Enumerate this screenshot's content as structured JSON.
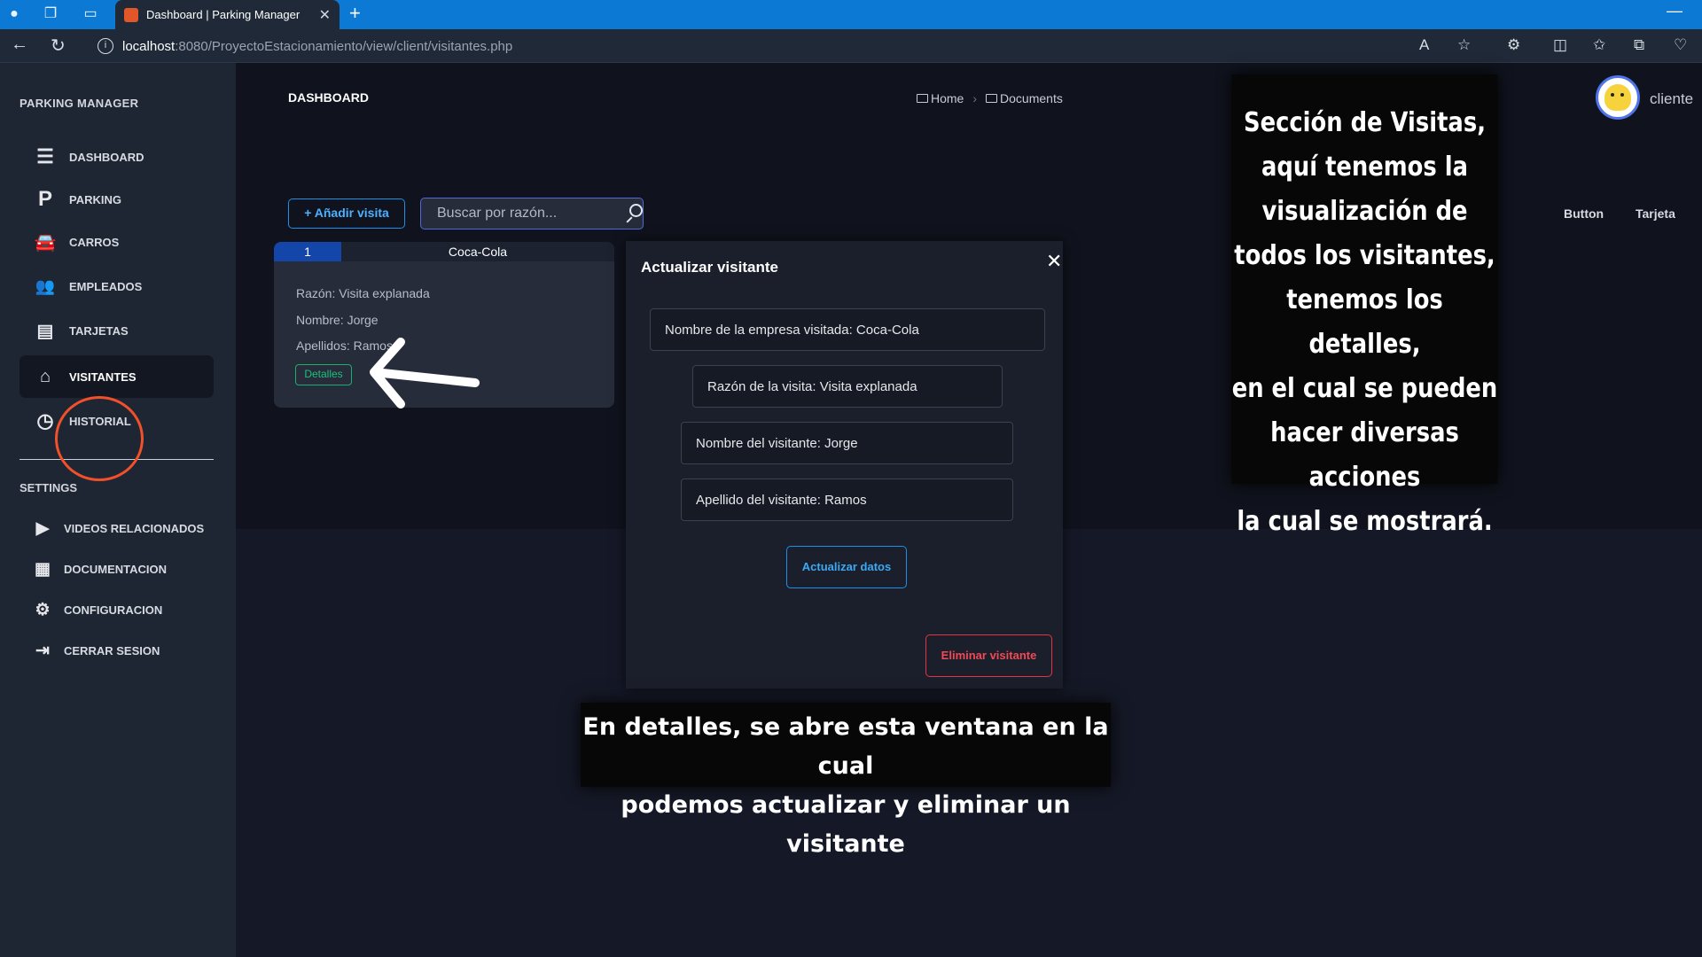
{
  "browser": {
    "tab_title": "Dashboard | Parking Manager",
    "tab_close": "✕",
    "new_tab": "+",
    "url_host": "localhost",
    "url_rest": ":8080/ProyectoEstacionamiento/view/client/visitantes.php"
  },
  "sidebar": {
    "brand": "PARKING MANAGER",
    "items": [
      {
        "label": "DASHBOARD",
        "icon": "menu-icon",
        "active": false
      },
      {
        "label": "PARKING",
        "icon": "parking-icon",
        "active": false
      },
      {
        "label": "CARROS",
        "icon": "car-icon",
        "active": false
      },
      {
        "label": "EMPLEADOS",
        "icon": "employees-icon",
        "active": false
      },
      {
        "label": "TARJETAS",
        "icon": "card-icon",
        "active": false
      },
      {
        "label": "VISITANTES",
        "icon": "visitors-icon",
        "active": true
      },
      {
        "label": "HISTORIAL",
        "icon": "history-icon",
        "active": false
      }
    ],
    "settings_title": "SETTINGS",
    "settings": [
      {
        "label": "VIDEOS RELACIONADOS",
        "icon": "play-icon"
      },
      {
        "label": "DOCUMENTACION",
        "icon": "document-icon"
      },
      {
        "label": "CONFIGURACION",
        "icon": "gears-icon"
      },
      {
        "label": "CERRAR SESION",
        "icon": "logout-icon"
      }
    ]
  },
  "header": {
    "title": "DASHBOARD",
    "breadcrumb": [
      "Home",
      "Documents"
    ],
    "user_name": "cliente",
    "right_button": "Button",
    "right_link": "Tarjeta"
  },
  "toolbar": {
    "add_label": "+ Añadir visita",
    "search_placeholder": "Buscar por razón..."
  },
  "visit_card": {
    "number": "1",
    "company": "Coca-Cola",
    "reason": "Razón: Visita explanada",
    "name": "Nombre: Jorge",
    "surname": "Apellidos: Ramos",
    "details_label": "Detalles"
  },
  "modal": {
    "title": "Actualizar visitante",
    "close": "✕",
    "fields": [
      "Nombre de la empresa visitada:  Coca-Cola",
      "Razón de la visita:  Visita explanada",
      "Nombre del visitante:  Jorge",
      "Apellido del visitante:  Ramos"
    ],
    "update_label": "Actualizar datos",
    "delete_label": "Eliminar visitante"
  },
  "annotations": {
    "right": "Sección de Visitas,\naquí tenemos la\nvisualización de\ntodos los visitantes,\ntenemos los detalles,\nen el cual se pueden\nhacer diversas acciones\nla cual se mostrará.",
    "bottom": "En detalles, se abre esta ventana en la cual\npodemos actualizar y eliminar un visitante"
  },
  "colors": {
    "accent_blue": "#1c8fe6",
    "success_green": "#1ec07d",
    "danger_red": "#f04a55",
    "highlight_orange": "#f0502a"
  }
}
